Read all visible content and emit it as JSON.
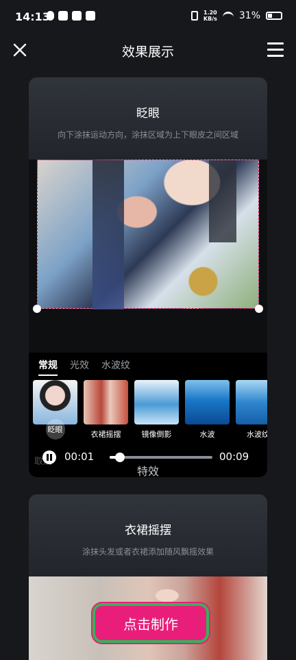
{
  "status": {
    "time": "14:13",
    "net_speed_top": "1.20",
    "net_speed_bottom": "KB/s",
    "battery": "31%"
  },
  "header": {
    "title": "效果展示"
  },
  "cards": [
    {
      "title": "眨眼",
      "subtitle": "向下涂抹运动方向，涂抹区域为上下眼皮之间区域",
      "tabs": [
        "常规",
        "光效",
        "水波纹"
      ],
      "active_tab": "常规",
      "effects": [
        {
          "label": "眨眼",
          "selected": true
        },
        {
          "label": "衣裙摇摆"
        },
        {
          "label": "镜像倒影"
        },
        {
          "label": "水波"
        },
        {
          "label": "水波纹"
        }
      ],
      "player": {
        "current": "00:01",
        "total": "00:09",
        "progress": 0.1,
        "ghost_left": "取消",
        "ghost_center": "特效"
      }
    },
    {
      "title": "衣裙摇摆",
      "subtitle": "涂抹头发或者衣裙添加随风飘摇效果"
    }
  ],
  "cta": {
    "label": "点击制作"
  },
  "colors": {
    "accent": "#e91e7a",
    "highlight_border": "#33b35a",
    "background": "#16181c"
  }
}
